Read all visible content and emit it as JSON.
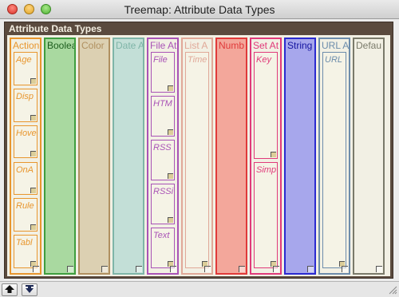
{
  "window": {
    "title": "Treemap: Attribute Data Types"
  },
  "treemap": {
    "title": "Attribute Data Types"
  },
  "columns": [
    {
      "label": "Action",
      "color": "#e8962e",
      "fill": "#f2f0e4",
      "notes": [
        "Age",
        "Disp",
        "Hove",
        "OnA",
        "Rule",
        "Tabl"
      ]
    },
    {
      "label": "Boolea",
      "color": "#3f9e3f",
      "fill": "#a9d9a0",
      "notes": []
    },
    {
      "label": "Color",
      "color": "#b09060",
      "fill": "#dcd0b2",
      "notes": []
    },
    {
      "label": "Date A",
      "color": "#7fb5a8",
      "fill": "#c3dfd7",
      "notes": []
    },
    {
      "label": "File At",
      "color": "#a953b6",
      "fill": "#f2f0e4",
      "notes": [
        "File",
        "HTM",
        "RSS",
        "RSSi",
        "Text"
      ]
    },
    {
      "label": "List A",
      "color": "#e0a898",
      "fill": "#f2f0e4",
      "notes": [
        "Time"
      ]
    },
    {
      "label": "Numb",
      "color": "#e03a3a",
      "fill": "#f3a79b",
      "notes": []
    },
    {
      "label": "Set At",
      "color": "#e03a7a",
      "fill": "#f2f0e4",
      "notes": [
        "Key",
        "Simp"
      ]
    },
    {
      "label": "String",
      "color": "#2a2ad0",
      "fill": "#a7a7ec",
      "notes": []
    },
    {
      "label": "URL A",
      "color": "#6c8cab",
      "fill": "#f2f0e4",
      "notes": [
        "URL"
      ]
    },
    {
      "label": "Defau",
      "color": "#7a7a6a",
      "fill": "#f2f0e4",
      "notes": []
    }
  ],
  "bottombar": {
    "up_icon": "up-arrow-icon",
    "down_icon": "down-arrow-icon"
  }
}
